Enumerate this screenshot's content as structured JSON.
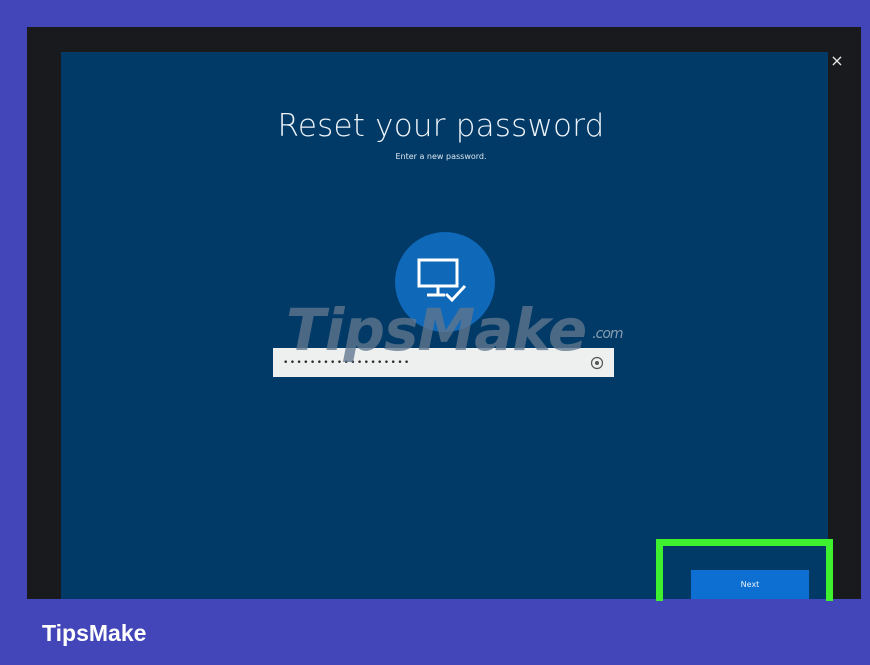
{
  "dialog": {
    "close_glyph": "×",
    "title": "Reset your password",
    "subtitle": "Enter a new password.",
    "avatar_icon": "pc-check-icon",
    "password": {
      "masked_value": "•••••••••••••••••••",
      "reveal_icon": "eye-icon"
    },
    "next_label": "Next"
  },
  "watermark": {
    "text": "TipsMake",
    "suffix": ".com"
  },
  "footer": {
    "brand": "TipsMake"
  },
  "colors": {
    "page_background": "#4346b8",
    "window_frame": "#191a1e",
    "panel_background": "#013a66",
    "avatar_circle": "#0f68b8",
    "next_button": "#0d6fd1",
    "highlight_box": "#3ef02d"
  }
}
